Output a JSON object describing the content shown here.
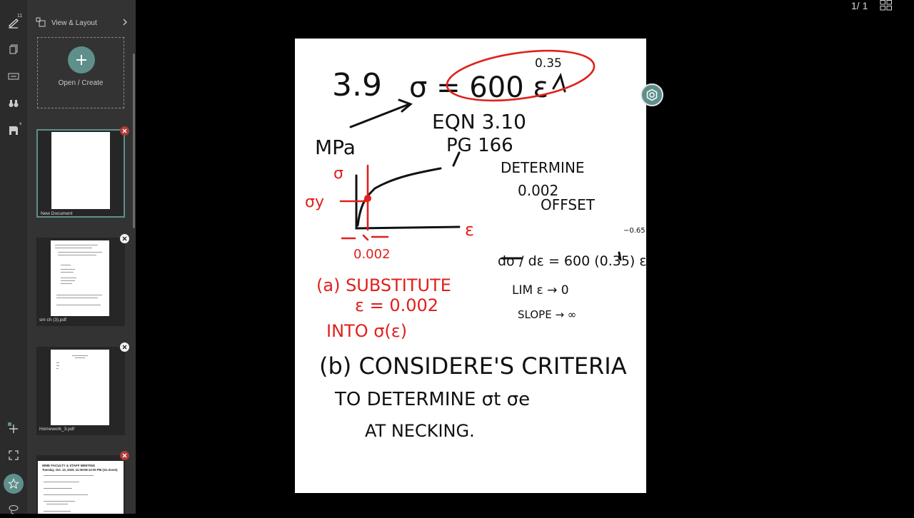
{
  "rail": {
    "badge_count": "11",
    "items": [
      {
        "icon": "pen-icon"
      },
      {
        "icon": "copy-pages-icon"
      },
      {
        "icon": "keyboard-icon"
      },
      {
        "icon": "binoculars-icon"
      },
      {
        "icon": "save-icon",
        "modified_marker": "*"
      },
      {
        "icon": "add-tool-icon",
        "badge": "+"
      },
      {
        "icon": "fullscreen-icon"
      },
      {
        "icon": "star-icon"
      },
      {
        "icon": "lasso-icon"
      }
    ]
  },
  "panel": {
    "header_label": "View & Layout",
    "open_create_label": "Open / Create",
    "documents": [
      {
        "name": "New Document",
        "active": true
      },
      {
        "name": "sm ch (3).pdf",
        "active": false
      },
      {
        "name": "Homework_3.pdf",
        "active": false
      },
      {
        "name": "",
        "active": false,
        "thumb_title": "WME FACULTY & STAFF MEETING",
        "thumb_subtitle": "Tuesday, Oct. 13, 2020, 11:00AM-12:00 PM (via Zoom)"
      }
    ]
  },
  "toolbar": {
    "page_count": "1/ 1"
  },
  "handwriting": {
    "problem": "3.9",
    "equation_left": "σ = 600 ε",
    "exponent": "0.35",
    "unit": "MPa",
    "eqn_ref": "EQN 3.10",
    "page_ref": "PG 166",
    "sigma_axis": "σ",
    "sigma_y": "σy",
    "epsilon_axis": "ε",
    "offset_value": "0.002",
    "determine_line1": "DETERMINE",
    "determine_line2": "0.002",
    "determine_line3": "OFFSET",
    "derivative": "dσ / dε = 600 (0.35) ε",
    "derivative_exp": "−0.65",
    "limit": "LIM ε → 0",
    "slope": "SLOPE → ∞",
    "part_a_1": "(a) SUBSTITUTE",
    "part_a_2": "ε = 0.002",
    "part_a_3": "INTO σ(ε)",
    "part_b_1": "(b) CONSIDERE'S CRITERIA",
    "part_b_2": "TO DETERMINE σt σe",
    "part_b_3": "AT NECKING."
  },
  "colors": {
    "accent": "#5e8f8b",
    "ink_black": "#111111",
    "ink_red": "#e0201c"
  }
}
